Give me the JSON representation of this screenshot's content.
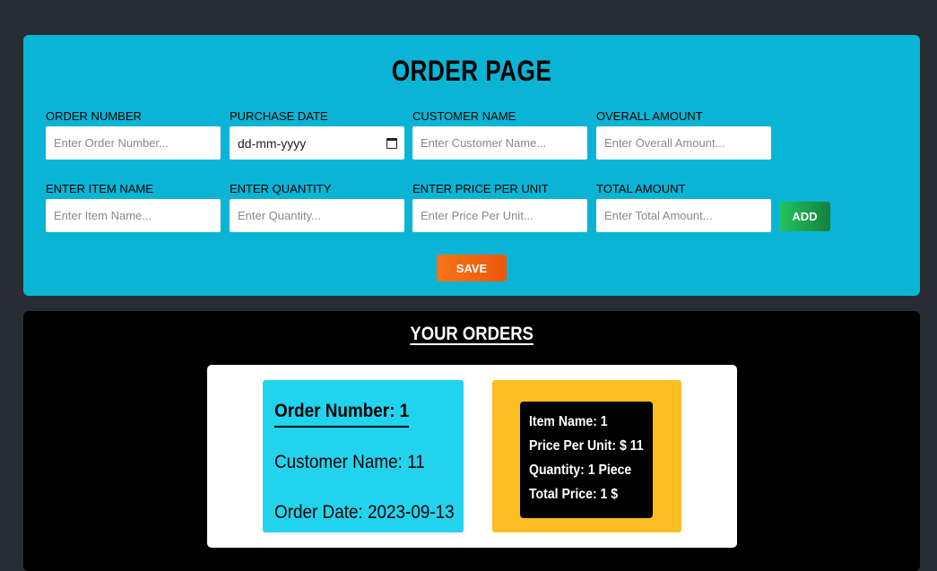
{
  "form": {
    "title": "ORDER PAGE",
    "order_number": {
      "label": "ORDER NUMBER",
      "placeholder": "Enter Order Number..."
    },
    "purchase_date": {
      "label": "PURCHASE DATE",
      "value": "dd-mm-yyyy"
    },
    "customer_name": {
      "label": "CUSTOMER NAME",
      "placeholder": "Enter Customer Name..."
    },
    "overall_amount": {
      "label": "OVERALL AMOUNT",
      "placeholder": "Enter Overall Amount..."
    },
    "item_name": {
      "label": "ENTER ITEM NAME",
      "placeholder": "Enter Item Name..."
    },
    "quantity": {
      "label": "ENTER QUANTITY",
      "placeholder": "Enter Quantity..."
    },
    "price_per_unit": {
      "label": "ENTER PRICE PER UNIT",
      "placeholder": "Enter Price Per Unit..."
    },
    "total_amount": {
      "label": "TOTAL AMOUNT",
      "placeholder": "Enter Total Amount..."
    },
    "add_label": "ADD",
    "save_label": "SAVE",
    "colors": {
      "panel": "#0ab4d4",
      "add": "#22c55e",
      "save": "#f97316"
    }
  },
  "orders": {
    "title": "YOUR ORDERS",
    "order": {
      "number": "Order Number: 1",
      "customer": "Customer Name: 11",
      "date": "Order Date: 2023-09-13",
      "items": {
        "name": "Item Name: 1",
        "price": "Price Per Unit: $ 11",
        "quantity": "Quantity: 1 Piece",
        "total": "Total Price: 1 $"
      }
    },
    "colors": {
      "info": "#22d3ee",
      "items": "#fbbf24"
    }
  }
}
